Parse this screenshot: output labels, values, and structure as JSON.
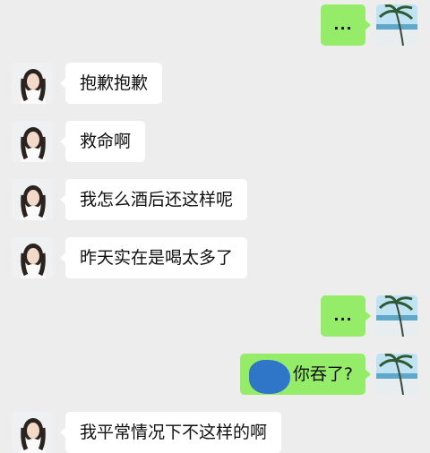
{
  "messages": [
    {
      "side": "right",
      "text": "..."
    },
    {
      "side": "left",
      "text": "抱歉抱歉"
    },
    {
      "side": "left",
      "text": "救命啊"
    },
    {
      "side": "left",
      "text": "我怎么酒后还这样呢"
    },
    {
      "side": "left",
      "text": "昨天实在是喝太多了"
    },
    {
      "side": "right",
      "text": "..."
    },
    {
      "side": "right",
      "text": "你吞了?",
      "partially_obscured": true
    },
    {
      "side": "left",
      "text": "我平常情况下不这样的啊",
      "partially_cut_off": true
    }
  ],
  "colors": {
    "background": "#ededed",
    "incoming_bubble": "#ffffff",
    "outgoing_bubble": "#95ec69",
    "redaction_scribble": "#2f76c8"
  },
  "avatars": {
    "contact": "girl-portrait-avatar",
    "self": "palm-beach-avatar"
  }
}
